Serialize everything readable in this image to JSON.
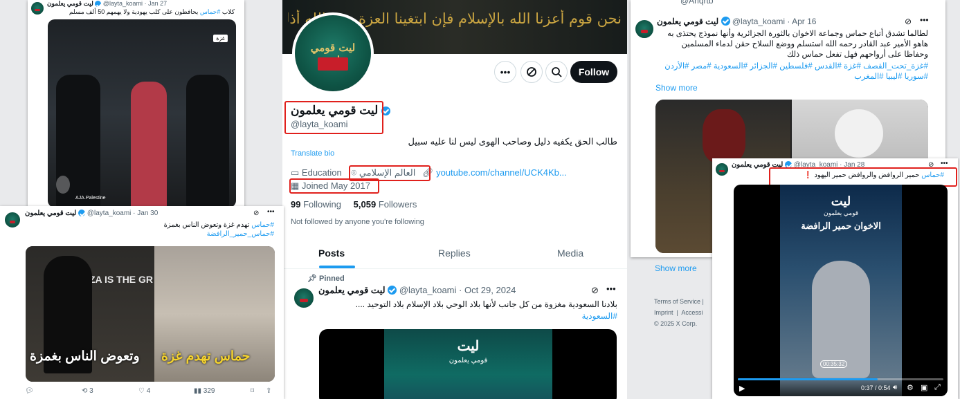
{
  "profile": {
    "name": "ليت قومي يعلمون",
    "handle": "@layta_koami",
    "bio": "طالب الحق يكفيه دليل وصاحب الهوى ليس لنا عليه سبيل",
    "translate": "Translate bio",
    "category": "Education",
    "location": "العالم الإسلامي",
    "website": "youtube.com/channel/UCK4Kb...",
    "joined": "Joined May 2017",
    "following_count": "99",
    "following_label": "Following",
    "followers_count": "5,059",
    "followers_label": "Followers",
    "not_followed": "Not followed by anyone you're following",
    "follow_btn": "Follow",
    "banner_text": "نحن قوم أعزنا الله بالإسلام فإن ابتغينا العزة بغير الله أذلنا الله",
    "avatar_text": "ليت قومي يعلمون",
    "avatar_small": "ليت",
    "avatar_small2": "قومي يعلمون"
  },
  "tabs": [
    "Posts",
    "Replies",
    "Media"
  ],
  "pinned": {
    "label": "Pinned",
    "date": "· Oct 29, 2024",
    "text": "بلادنا السعودية مغزوة من كل جانب لأنها بلاد الوحي بلاد الإسلام  بلاد التوحيد ....",
    "hashtag": "#السعودية"
  },
  "tweet_jan27": {
    "date": "· Jan 27",
    "text_rest": " يحافظون على كلب يهودية ولا يهمهم 50 ألف مسلم",
    "text_tag": "#حماس",
    "text_pre": "كلاب ",
    "video_label": "غزة",
    "credit": "AJA.Palestine"
  },
  "tweet_jan30": {
    "date": "· Jan 30",
    "line1_tag": "#حماس",
    "line1_rest": " تهدم غزة وتعوض الناس بغمزة",
    "line2": "#حماس_حمير_الرافضة",
    "caption_right": "حماس تهدم غزة",
    "caption_left": "وتعوض الناس بغمزة",
    "sign": "ZA IS THE GR",
    "replies": "",
    "retweets": "3",
    "likes": "4",
    "views": "329"
  },
  "tweet_apr16": {
    "top_handle": "@Ahqrtb",
    "date": "· Apr 16",
    "text": "لطالما تشدق أتباع حماس وجماعة الاخوان بالثورة الجزائرية وأنها نموذج يحتذى به هاهو الأمير عبد القادر رحمه الله استسلم ووضع السلاح حقن لدماء المسلمين وحفاظا على أرواحهم فهل تفعل حماس ذلك",
    "hashtags1": "#غزة_تحت_القصف #غزة #القدس #فلسطين #الجزائر #السعودية #مصر #الأردن",
    "hashtags2": "#سوريا #ليبيا #المغرب",
    "show_more": "Show more",
    "show_more2": "Show more"
  },
  "footer": {
    "terms": "Terms of Service",
    "imprint": "Imprint",
    "access": "Accessi",
    "copy": "© 2025 X Corp."
  },
  "tweet_jan28": {
    "date": "· Jan 28",
    "tag": "#حماس",
    "text": " حمير الروافض والروافض حمير اليهود",
    "excl": "❗",
    "video_title": "الاخوان حمير الرافضة",
    "video_brand": "ليت",
    "video_brand2": "قومي يعلمون",
    "time": "0:37 / 0:54",
    "clock": "00:35:32"
  },
  "colors": {
    "accent": "#1d9bf0",
    "highlight": "#e0201c",
    "brand_green": "#0f5546"
  }
}
